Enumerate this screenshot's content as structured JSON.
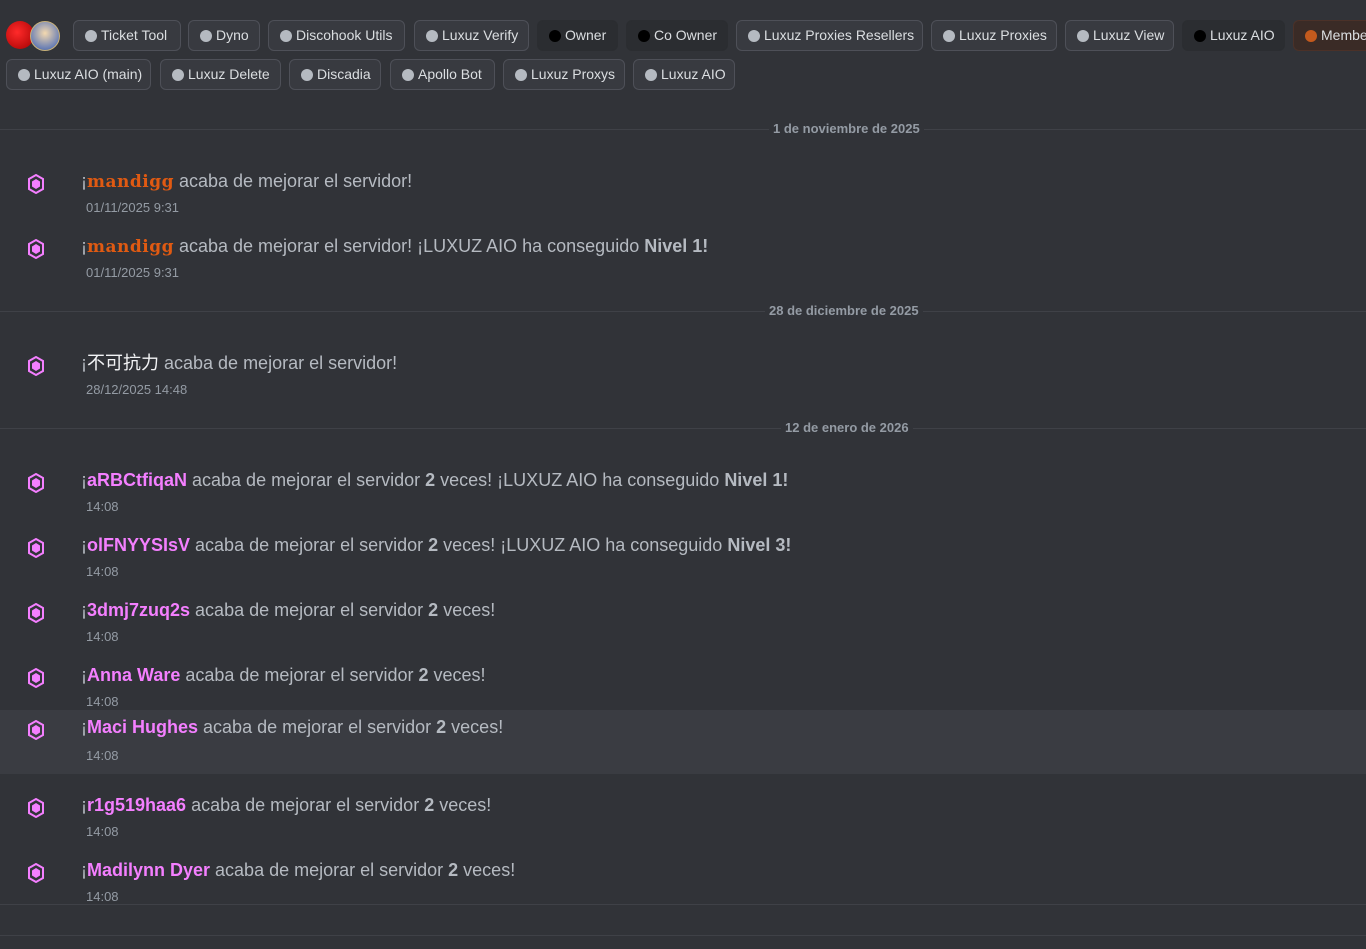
{
  "roles_bar": {
    "items": [
      {
        "label": "Ticket Tool",
        "dot": "#b5bac1",
        "style": "normal"
      },
      {
        "label": "Dyno",
        "dot": "#b5bac1",
        "style": "normal"
      },
      {
        "label": "Discohook Utils",
        "dot": "#b5bac1",
        "style": "normal"
      },
      {
        "label": "Luxuz Verify",
        "dot": "#b5bac1",
        "style": "normal"
      },
      {
        "label": "Owner",
        "dot": "#000000",
        "style": "dark"
      },
      {
        "label": "Co Owner",
        "dot": "#000000",
        "style": "dark"
      },
      {
        "label": "Luxuz Proxies Resellers",
        "dot": "#b5bac1",
        "style": "normal"
      },
      {
        "label": "Luxuz Proxies",
        "dot": "#b5bac1",
        "style": "normal"
      },
      {
        "label": "Luxuz View",
        "dot": "#b5bac1",
        "style": "normal"
      },
      {
        "label": "Luxuz AIO",
        "dot": "#000000",
        "style": "dark"
      },
      {
        "label": "Membe",
        "dot": "#c45a1d",
        "style": "member"
      },
      {
        "label": "Luxuz AIO (main)",
        "dot": "#b5bac1",
        "style": "normal"
      },
      {
        "label": "Luxuz Delete",
        "dot": "#b5bac1",
        "style": "normal"
      },
      {
        "label": "Discadia",
        "dot": "#b5bac1",
        "style": "normal"
      },
      {
        "label": "Apollo Bot",
        "dot": "#b5bac1",
        "style": "normal"
      },
      {
        "label": "Luxuz Proxys",
        "dot": "#b5bac1",
        "style": "normal"
      },
      {
        "label": "Luxuz AIO",
        "dot": "#b5bac1",
        "style": "normal"
      }
    ]
  },
  "colors": {
    "background": "#313338",
    "boost_pink": "#f47fff",
    "text_muted": "#b5bac1",
    "timestamp": "#949ba4",
    "mandigg_orange": "#e05a12"
  },
  "boost_icon": "server-boost-gem-icon",
  "dates": [
    "1 de noviembre de 2025",
    "28 de diciembre de 2025",
    "12 de enero de 2026"
  ],
  "messages": [
    {
      "prefix": "¡",
      "name": "mandigg",
      "rest": " acaba de mejorar el servidor!",
      "count": "",
      "tail": "",
      "level": "",
      "time": "01/11/2025 9:31"
    },
    {
      "prefix": "¡",
      "name": "mandigg",
      "rest": " acaba de mejorar el servidor! ¡LUXUZ AIO ha conseguido ",
      "count": "",
      "tail": "",
      "level": "Nivel 1!",
      "time": "01/11/2025 9:31"
    },
    {
      "prefix": "¡",
      "name": "不可抗力",
      "rest": " acaba de mejorar el servidor!",
      "count": "",
      "tail": "",
      "level": "",
      "time": "28/12/2025 14:48"
    },
    {
      "prefix": "¡",
      "name": "aRBCtfiqaN",
      "rest": " acaba de mejorar el servidor ",
      "count": "2",
      "tail": " veces! ¡LUXUZ AIO ha conseguido ",
      "level": "Nivel 1!",
      "time": "14:08"
    },
    {
      "prefix": "¡",
      "name": "olFNYYSIsV",
      "rest": " acaba de mejorar el servidor ",
      "count": "2",
      "tail": " veces! ¡LUXUZ AIO ha conseguido ",
      "level": "Nivel 3!",
      "time": "14:08"
    },
    {
      "prefix": "¡",
      "name": "3dmj7zuq2s",
      "rest": " acaba de mejorar el servidor ",
      "count": "2",
      "tail": " veces!",
      "level": "",
      "time": "14:08"
    },
    {
      "prefix": "¡",
      "name": "Anna Ware",
      "rest": " acaba de mejorar el servidor ",
      "count": "2",
      "tail": " veces!",
      "level": "",
      "time": "14:08"
    },
    {
      "prefix": "¡",
      "name": "Maci Hughes",
      "rest": " acaba de mejorar el servidor ",
      "count": "2",
      "tail": " veces!",
      "level": "",
      "time": "14:08"
    },
    {
      "prefix": "¡",
      "name": "r1g519haa6",
      "rest": " acaba de mejorar el servidor ",
      "count": "2",
      "tail": " veces!",
      "level": "",
      "time": "14:08"
    },
    {
      "prefix": "¡",
      "name": "Madilynn Dyer",
      "rest": " acaba de mejorar el servidor ",
      "count": "2",
      "tail": " veces!",
      "level": "",
      "time": "14:08"
    }
  ]
}
